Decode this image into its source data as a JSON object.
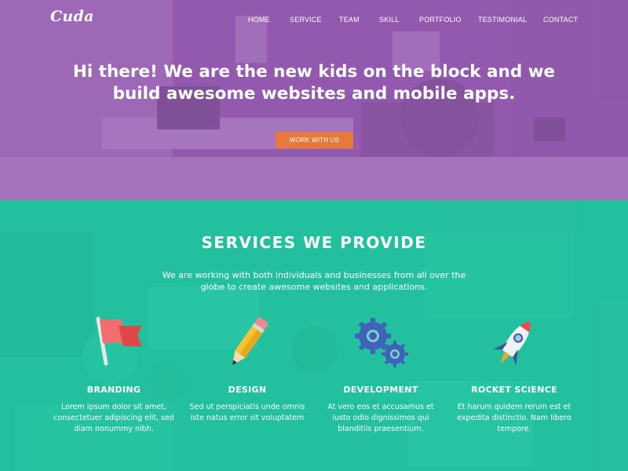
{
  "brand": {
    "logo": "Cuda"
  },
  "nav": [
    "HOME",
    "SERVICE",
    "TEAM",
    "SKILL",
    "PORTFOLIO",
    "TESTIMONIAL",
    "CONTACT"
  ],
  "hero": {
    "title": "Hi there! We are the new kids on the block and we build awesome websites and mobile apps.",
    "cta": "WORK WITH US",
    "overlay_color": "#9658b2"
  },
  "services": {
    "title": "SERVICES WE PROVIDE",
    "description": "We are working with both individuals and businesses from all over the globe to create awesome websites and applications.",
    "overlay_color": "#22c9a5",
    "items": [
      {
        "icon": "flag-icon",
        "name": "BRANDING",
        "text": "Lorem ipsum dolor sit amet, consectetuer adipiscing elit, sed diam nonummy nibh."
      },
      {
        "icon": "pencil-icon",
        "name": "DESIGN",
        "text": "Sed ut perspiciatis unde omnis iste natus error sit voluptatem"
      },
      {
        "icon": "gears-icon",
        "name": "DEVELOPMENT",
        "text": "At vero eos et accusamus et iusto odio dignissimos qui blanditiis praesentium."
      },
      {
        "icon": "rocket-icon",
        "name": "ROCKET SCIENCE",
        "text": "Et harum quidem rerum est et expedita distinctio. Nam libero tempore."
      }
    ]
  },
  "colors": {
    "accent": "#e8793d",
    "purple": "#9b5fb4",
    "teal": "#28c8a8"
  }
}
